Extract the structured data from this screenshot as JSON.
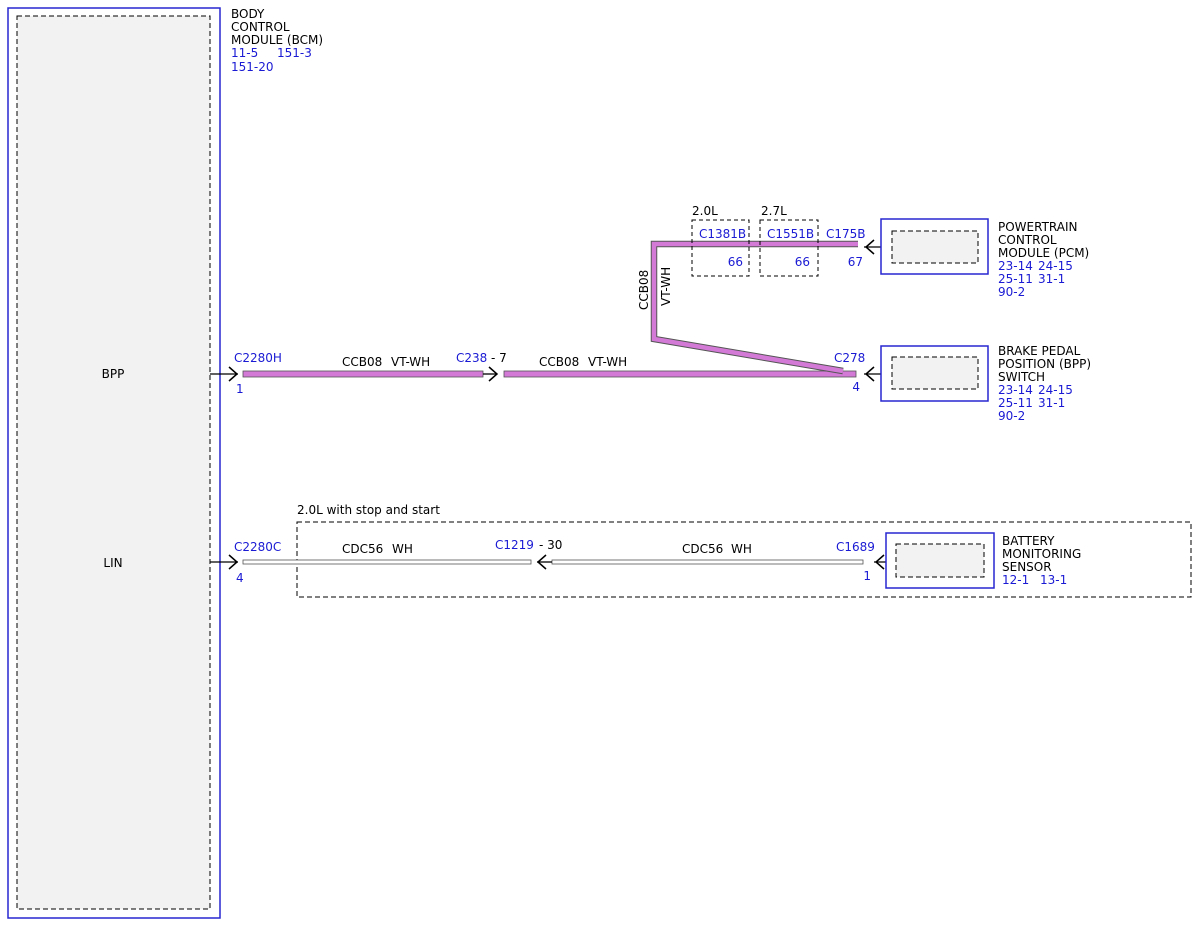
{
  "colors": {
    "module_outline": "#2626d0",
    "module_fill": "#f2f2f2",
    "reference_text": "#1a1ad4",
    "wire_violet_white": "#d27ad6",
    "wire_white": "#ffffff",
    "wire_outline": "#555555"
  },
  "bcm": {
    "name_lines": [
      "BODY",
      "CONTROL",
      "MODULE (BCM)"
    ],
    "refs_line1_a": "11-5",
    "refs_line1_b": "151-3",
    "refs_line2": "151-20",
    "pin_bpp_label": "BPP",
    "pin_lin_label": "LIN"
  },
  "pcm": {
    "name_lines": [
      "POWERTRAIN",
      "CONTROL",
      "MODULE (PCM)"
    ],
    "refs": [
      [
        "23-14",
        "24-15"
      ],
      [
        "25-11",
        "31-1"
      ],
      [
        "90-2"
      ]
    ]
  },
  "bpp": {
    "name_lines": [
      "BRAKE PEDAL",
      "POSITION (BPP)",
      "SWITCH"
    ],
    "refs": [
      [
        "23-14",
        "24-15"
      ],
      [
        "25-11",
        "31-1"
      ],
      [
        "90-2"
      ]
    ]
  },
  "bms": {
    "name_lines": [
      "BATTERY",
      "MONITORING",
      "SENSOR"
    ],
    "refs": [
      [
        "12-1",
        "13-1"
      ]
    ]
  },
  "bpp_circuit": {
    "c2280h": {
      "connector": "C2280H",
      "pin": "1"
    },
    "c238": {
      "connector": "C238",
      "pin": "- 7"
    },
    "c278": {
      "connector": "C278",
      "pin": "4"
    },
    "wire_left": {
      "circuit": "CCB08",
      "color": "VT-WH"
    },
    "wire_right": {
      "circuit": "CCB08",
      "color": "VT-WH"
    },
    "wire_vertical": {
      "circuit": "CCB08",
      "color": "VT-WH"
    },
    "c1381b": {
      "variant": "2.0L",
      "connector": "C1381B",
      "pin": "66"
    },
    "c1551b": {
      "variant": "2.7L",
      "connector": "C1551B",
      "pin": "66"
    },
    "c175b": {
      "connector": "C175B",
      "pin": "67"
    }
  },
  "lin_circuit": {
    "condition_label": "2.0L with stop and start",
    "c2280c": {
      "connector": "C2280C",
      "pin": "4"
    },
    "c1219": {
      "connector": "C1219",
      "pin": "- 30"
    },
    "c1689": {
      "connector": "C1689",
      "pin": "1"
    },
    "wire_left": {
      "circuit": "CDC56",
      "color": "WH"
    },
    "wire_right": {
      "circuit": "CDC56",
      "color": "WH"
    }
  }
}
